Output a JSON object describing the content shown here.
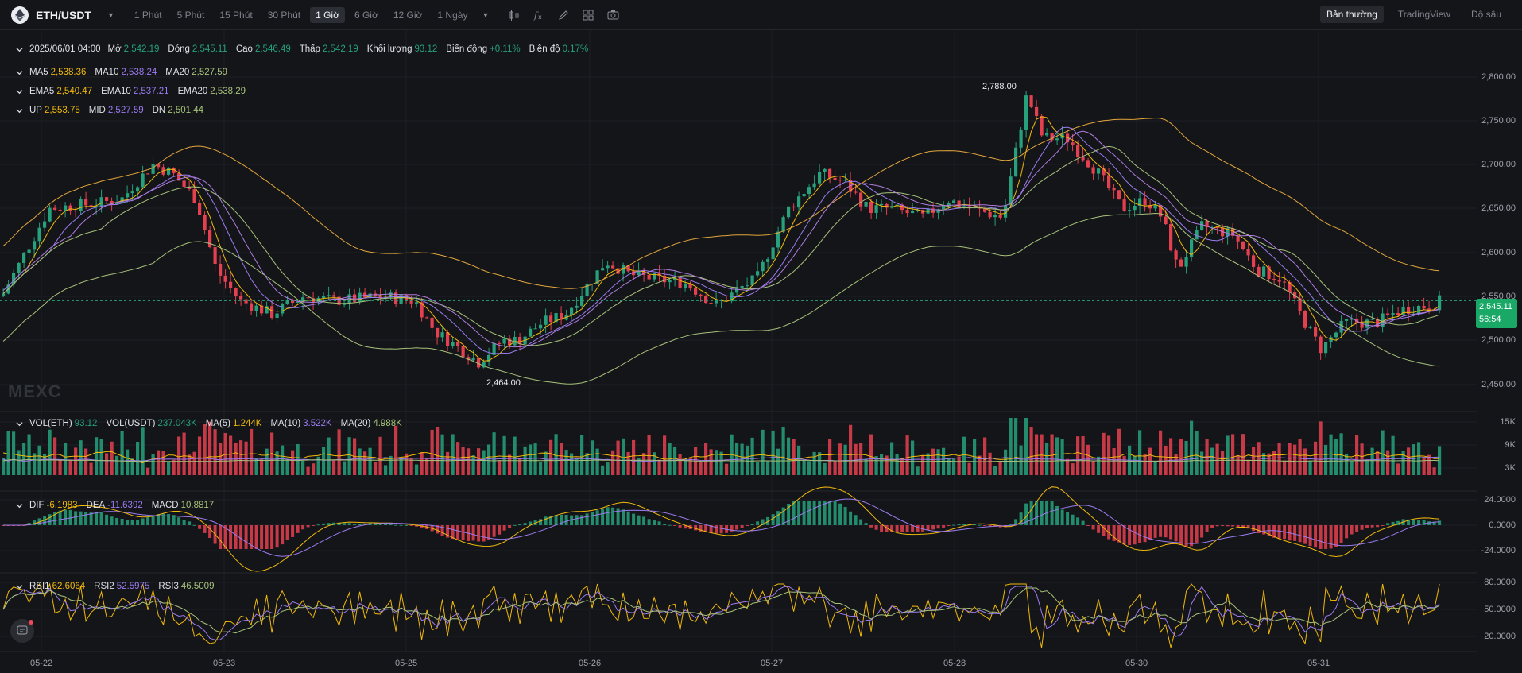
{
  "toolbar": {
    "pair": "ETH/USDT",
    "coin_icon": "ethereum-icon",
    "intervals": [
      "1 Phút",
      "5 Phút",
      "15 Phút",
      "30 Phút",
      "1 Giờ",
      "6 Giờ",
      "12 Giờ",
      "1 Ngày"
    ],
    "active_interval": "1 Giờ",
    "tool_icons": [
      "candle-type-icon",
      "indicator-fx-icon",
      "draw-pencil-icon",
      "layout-grid-icon",
      "camera-icon"
    ],
    "views": [
      "Bản thường",
      "TradingView",
      "Độ sâu"
    ],
    "active_view": "Bản thường"
  },
  "ohlc": {
    "date": "2025/06/01 04:00",
    "open_label": "Mở",
    "open": "2,542.19",
    "close_label": "Đóng",
    "close": "2,545.11",
    "high_label": "Cao",
    "high": "2,546.49",
    "low_label": "Thấp",
    "low": "2,542.19",
    "volume_label": "Khối lượng",
    "volume": "93.12",
    "change_label": "Biến động",
    "change": "+0.11%",
    "amplitude_label": "Biên độ",
    "amplitude": "0.17%"
  },
  "ma": {
    "ma5_label": "MA5",
    "ma5": "2,538.36",
    "ma10_label": "MA10",
    "ma10": "2,538.24",
    "ma20_label": "MA20",
    "ma20": "2,527.59"
  },
  "ema": {
    "ema5_label": "EMA5",
    "ema5": "2,540.47",
    "ema10_label": "EMA10",
    "ema10": "2,537.21",
    "ema20_label": "EMA20",
    "ema20": "2,538.29"
  },
  "boll": {
    "up_label": "UP",
    "up": "2,553.75",
    "mid_label": "MID",
    "mid": "2,527.59",
    "dn_label": "DN",
    "dn": "2,501.44"
  },
  "vol": {
    "vol_eth_label": "VOL(ETH)",
    "vol_eth": "93.12",
    "vol_usdt_label": "VOL(USDT)",
    "vol_usdt": "237.043K",
    "ma5_label": "MA(5)",
    "ma5": "1.244K",
    "ma10_label": "MA(10)",
    "ma10": "3.522K",
    "ma20_label": "MA(20)",
    "ma20": "4.988K"
  },
  "macd": {
    "dif_label": "DIF",
    "dif": "-6.1983",
    "dea_label": "DEA",
    "dea": "-11.6392",
    "macd_label": "MACD",
    "macd": "10.8817"
  },
  "rsi": {
    "rsi1_label": "RSI1",
    "rsi1": "62.6064",
    "rsi2_label": "RSI2",
    "rsi2": "52.5975",
    "rsi3_label": "RSI3",
    "rsi3": "46.5009"
  },
  "price_axis": [
    "2,800.00",
    "2,750.00",
    "2,700.00",
    "2,650.00",
    "2,600.00",
    "2,550.00",
    "2,500.00",
    "2,450.00"
  ],
  "vol_axis": [
    "15K",
    "9K",
    "3K"
  ],
  "macd_axis": [
    "24.0000",
    "0.0000",
    "-24.0000"
  ],
  "rsi_axis": [
    "80.0000",
    "50.0000",
    "20.0000"
  ],
  "x_axis": [
    "05-22",
    "05-23",
    "05-25",
    "05-26",
    "05-27",
    "05-28",
    "05-30",
    "05-31"
  ],
  "last_price": {
    "price": "2,545.11",
    "countdown": "56:54"
  },
  "annotations": {
    "high_mark": "2,788.00",
    "low_mark": "2,464.00"
  },
  "watermark": "MEXC",
  "colors": {
    "up": "#26a17b",
    "down": "#e5404f",
    "ma5": "#f0b90b",
    "ma10": "#9b7bf0",
    "ma20": "#a7c27a",
    "boll": "#e2a63b",
    "bg": "#141519"
  }
}
